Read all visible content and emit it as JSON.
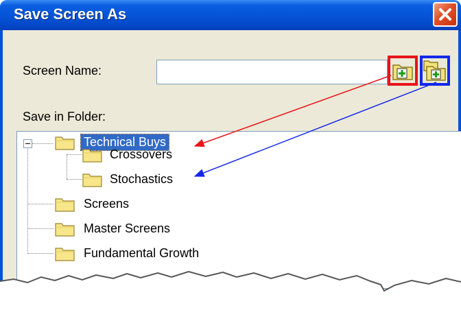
{
  "window": {
    "title": "Save Screen As"
  },
  "form": {
    "screen_name_label": "Screen Name:",
    "screen_name_value": "",
    "save_in_label": "Save in Folder:"
  },
  "toolbar": {
    "new_folder_icon": "new-folder-icon",
    "new_subfolder_icon": "new-subfolder-icon",
    "highlight_colors": {
      "new_folder": "#e8141a",
      "new_subfolder": "#1428e8"
    }
  },
  "tree": {
    "items": [
      {
        "label": "Technical Buys",
        "level": 0,
        "expanded": true,
        "selected": true
      },
      {
        "label": "Crossovers",
        "level": 1
      },
      {
        "label": "Stochastics",
        "level": 1
      },
      {
        "label": "Screens",
        "level": 0
      },
      {
        "label": "Master Screens",
        "level": 0
      },
      {
        "label": "Fundamental Growth",
        "level": 0
      }
    ]
  },
  "colors": {
    "titlebar": "#0553d6",
    "selection": "#316ac5",
    "dialog_bg": "#ece9d8"
  }
}
